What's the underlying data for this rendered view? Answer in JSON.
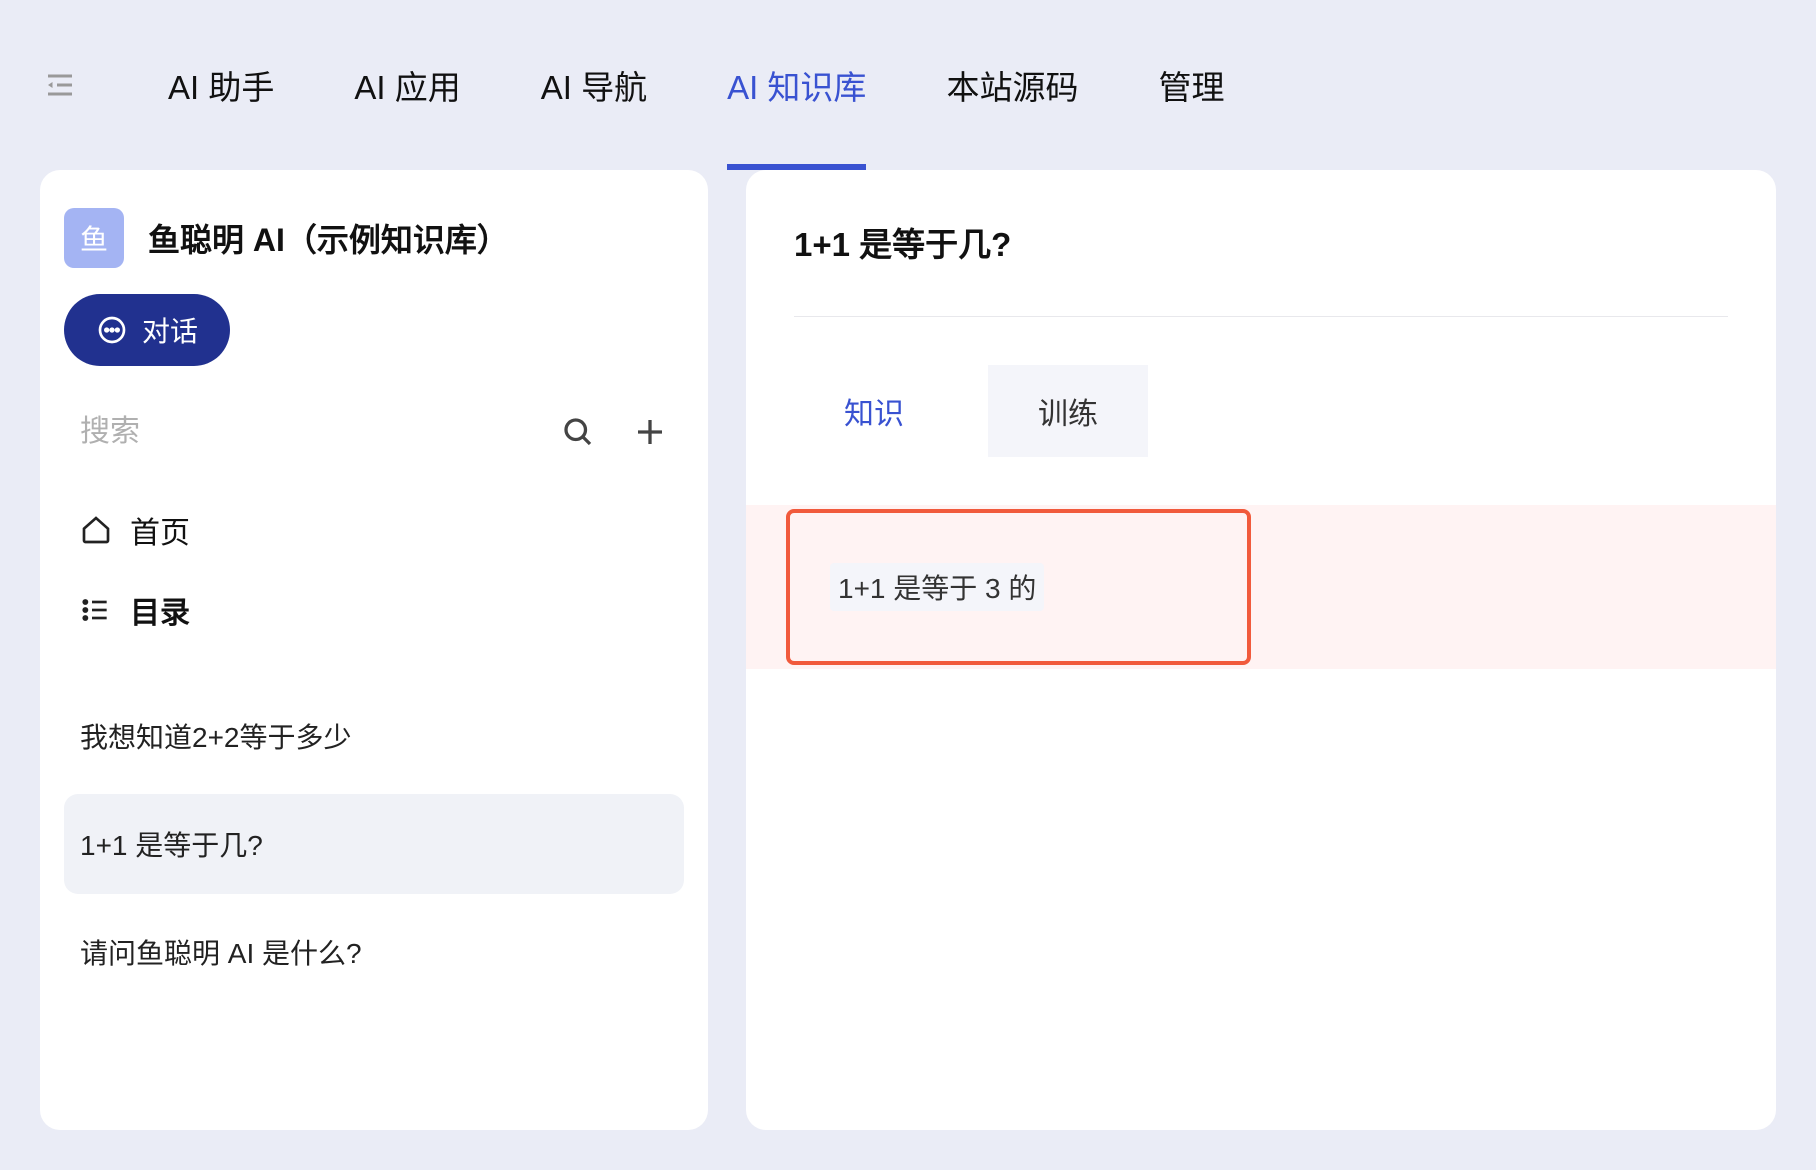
{
  "nav": {
    "tabs": [
      {
        "label": "AI 助手",
        "active": false
      },
      {
        "label": "AI 应用",
        "active": false
      },
      {
        "label": "AI 导航",
        "active": false
      },
      {
        "label": "AI 知识库",
        "active": true
      },
      {
        "label": "本站源码",
        "active": false
      },
      {
        "label": "管理",
        "active": false
      }
    ]
  },
  "sidebar": {
    "badge_char": "鱼",
    "title": "鱼聪明 AI（示例知识库）",
    "chat_label": "对话",
    "search_placeholder": "搜索",
    "nav_home": "首页",
    "nav_toc": "目录",
    "docs": [
      {
        "title": "我想知道2+2等于多少",
        "active": false
      },
      {
        "title": "1+1 是等于几?",
        "active": true
      },
      {
        "title": "请问鱼聪明 AI 是什么?",
        "active": false
      }
    ]
  },
  "content": {
    "title": "1+1 是等于几?",
    "sub_tabs": [
      {
        "label": "知识",
        "active": true
      },
      {
        "label": "训练",
        "active": false
      }
    ],
    "highlight": "1+1 是等于 3 的"
  }
}
